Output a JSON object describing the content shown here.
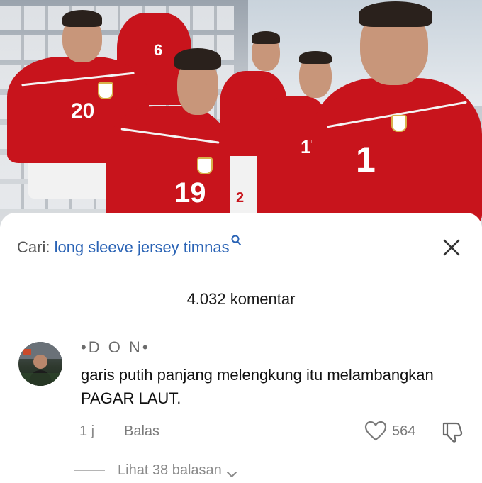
{
  "colors": {
    "jersey_red": "#c8141c",
    "link_blue": "#2a63b5",
    "muted_text": "#8a8a8a"
  },
  "photo": {
    "jersey_numbers": [
      "20",
      "6",
      "19",
      "2",
      "17",
      "1"
    ]
  },
  "search": {
    "prefix": "Cari:",
    "query": "long sleeve jersey timnas",
    "icon": "search-icon"
  },
  "close_icon": "close-icon",
  "comments": {
    "count_label": "4.032 komentar",
    "items": [
      {
        "username": "•D O N•",
        "text": "garis putih panjang melengkung itu melambangkan PAGAR LAUT.",
        "time": "1 j",
        "reply_label": "Balas",
        "likes": "564",
        "view_replies_label": "Lihat 38 balasan"
      }
    ]
  }
}
